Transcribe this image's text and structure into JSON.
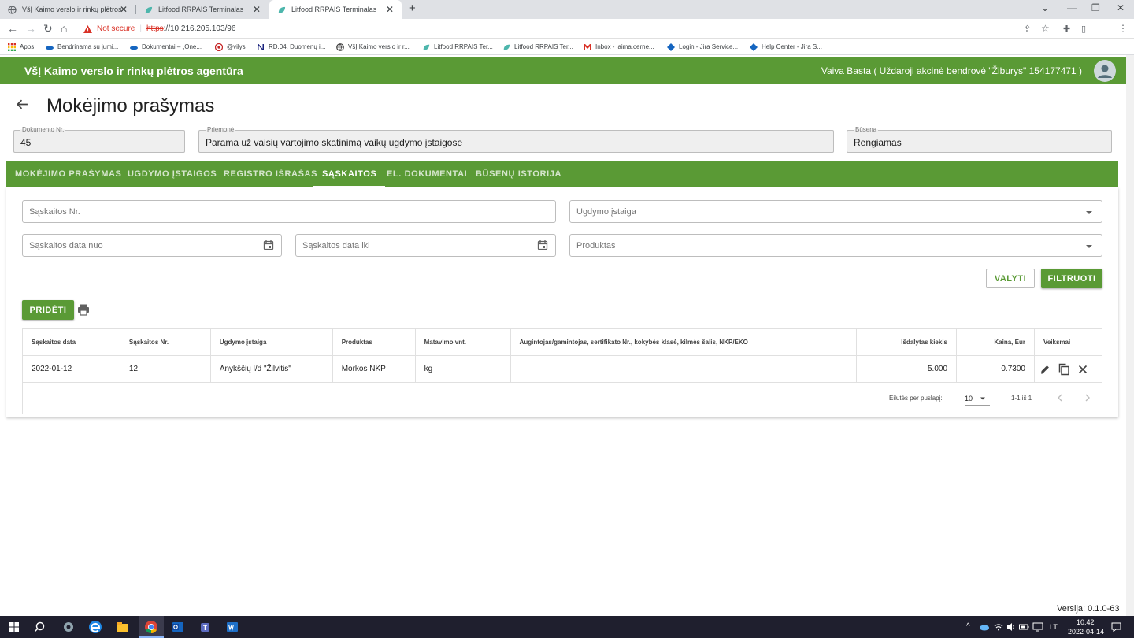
{
  "browser": {
    "tabs": [
      {
        "title": "VšĮ Kaimo verslo ir rinkų plėtros",
        "active": false
      },
      {
        "title": "Litfood RRPAIS Terminalas",
        "active": false
      },
      {
        "title": "Litfood RRPAIS Terminalas",
        "active": true
      }
    ],
    "security_label": "Not secure",
    "url_scheme": "https",
    "url_rest": "://10.216.205.103/96",
    "bookmarks": [
      {
        "label": "Apps",
        "icon": "apps-grid-icon"
      },
      {
        "label": "Bendrinama su jumi...",
        "icon": "onedrive-icon"
      },
      {
        "label": "Dokumentai – „One...",
        "icon": "onedrive-icon"
      },
      {
        "label": "@vilys",
        "icon": "at-icon"
      },
      {
        "label": "RD.04. Duomenų i...",
        "icon": "notion-icon"
      },
      {
        "label": "VšĮ Kaimo verslo ir r...",
        "icon": "globe-icon"
      },
      {
        "label": "Litfood RRPAIS Ter...",
        "icon": "leaf-icon"
      },
      {
        "label": "Litfood RRPAIS Ter...",
        "icon": "leaf-icon"
      },
      {
        "label": "Inbox - laima.cerne...",
        "icon": "gmail-icon"
      },
      {
        "label": "Login - Jira Service...",
        "icon": "jira-icon"
      },
      {
        "label": "Help Center - Jira S...",
        "icon": "jira-icon"
      }
    ]
  },
  "app": {
    "org_name": "VšĮ Kaimo verslo ir rinkų plėtros agentūra",
    "user": "Vaiva Basta ( Uždaroji akcinė bendrovė \"Žiburys\" 154177471 )",
    "brand_color": "#5a9a35"
  },
  "page": {
    "back_icon": "arrow-left-icon",
    "title": "Mokėjimo prašymas",
    "fields": {
      "doc_no": {
        "label": "Dokumento Nr.",
        "value": "45"
      },
      "measure": {
        "label": "Priemonė",
        "value": "Parama už vaisių vartojimo skatinimą vaikų ugdymo įstaigose"
      },
      "status": {
        "label": "Būsena",
        "value": "Rengiamas"
      }
    },
    "tabs": [
      "MOKĖJIMO PRAŠYMAS",
      "UGDYMO ĮSTAIGOS",
      "REGISTRO IŠRAŠAS",
      "SĄSKAITOS",
      "EL. DOKUMENTAI",
      "BŪSENŲ ISTORIJA"
    ],
    "active_tab": "SĄSKAITOS"
  },
  "filters": {
    "invoice_no_placeholder": "Sąskaitos Nr.",
    "institution_placeholder": "Ugdymo įstaiga",
    "date_from_placeholder": "Sąskaitos data nuo",
    "date_to_placeholder": "Sąskaitos data iki",
    "product_placeholder": "Produktas",
    "clear_label": "VALYTI",
    "filter_label": "FILTRUOTI"
  },
  "actions": {
    "add_label": "PRIDĖTI"
  },
  "table": {
    "columns": [
      "Sąskaitos data",
      "Sąskaitos Nr.",
      "Ugdymo įstaiga",
      "Produktas",
      "Matavimo vnt.",
      "Augintojas/gamintojas, sertifikato Nr., kokybės klasė, kilmės šalis, NKP/EKO",
      "Išdalytas kiekis",
      "Kaina, Eur",
      "Veiksmai"
    ],
    "rows": [
      {
        "date": "2022-01-12",
        "invoice_no": "12",
        "institution": "Anykščių l/d \"Žilvitis\"",
        "product": "Morkos NKP",
        "unit": "kg",
        "grower": "",
        "quantity": "5.000",
        "price": "0.7300"
      }
    ],
    "pagination": {
      "rows_per_page_label": "Eilutės per puslapį:",
      "rows_per_page": "10",
      "range": "1-1 iš 1"
    }
  },
  "version": "Versija: 0.1.0-63",
  "taskbar": {
    "lang": "LT",
    "time": "10:42",
    "date": "2022-04-14"
  }
}
